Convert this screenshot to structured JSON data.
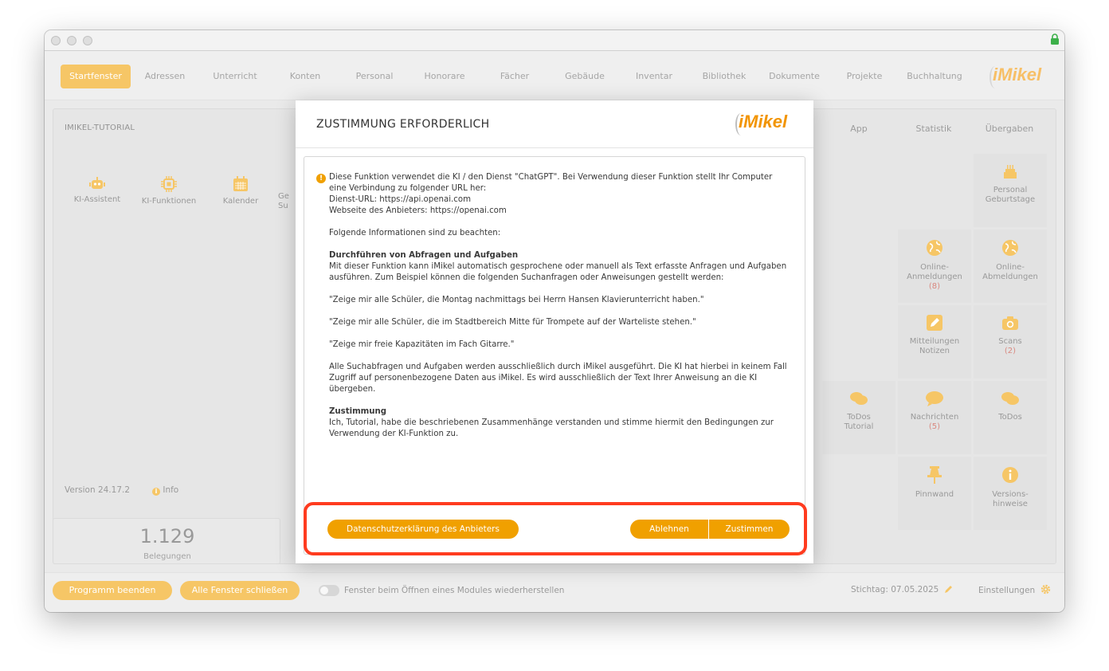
{
  "nav": {
    "items": [
      "Startfenster",
      "Adressen",
      "Unterricht",
      "Konten",
      "Personal",
      "Honorare",
      "Fächer",
      "Gebäude",
      "Inventar",
      "Bibliothek",
      "Dokumente",
      "Projekte",
      "Buchhaltung"
    ],
    "active_index": 0,
    "logo_text": "iMikel"
  },
  "panel": {
    "title": "IMIKEL-TUTORIAL",
    "tiles": [
      {
        "label": "KI-Assistent",
        "icon": "robot-icon"
      },
      {
        "label": "KI-Funktionen",
        "icon": "chip-icon"
      },
      {
        "label": "Kalender",
        "icon": "calendar-icon"
      }
    ],
    "partial_tile_label_1": "Ge",
    "partial_tile_label_2": "Su",
    "version": "Version 24.17.2",
    "info_label": "Info"
  },
  "right_tabs": [
    "App",
    "Statistik",
    "Übergaben"
  ],
  "right_tiles": [
    {
      "line1": "Personal",
      "line2": "Geburtstage",
      "count": "",
      "icon": "cake-icon"
    },
    {
      "line1": "Online-",
      "line2": "Anmeldungen",
      "count": "(8)",
      "icon": "globe-icon"
    },
    {
      "line1": "Online-",
      "line2": "Abmeldungen",
      "count": "",
      "icon": "globe-icon"
    },
    {
      "line1": "Mitteilungen",
      "line2": "Notizen",
      "count": "",
      "icon": "edit-icon"
    },
    {
      "line1": "Scans",
      "line2": "",
      "count": "(2)",
      "icon": "camera-icon"
    },
    {
      "line1": "ToDos",
      "line2": "Tutorial",
      "count": "",
      "icon": "chat-icon"
    },
    {
      "line1": "Nachrichten",
      "line2": "",
      "count": "(5)",
      "icon": "chat-icon"
    },
    {
      "line1": "ToDos",
      "line2": "",
      "count": "",
      "icon": "chat-icon"
    },
    {
      "line1": "Pinnwand",
      "line2": "",
      "count": "",
      "icon": "pin-icon"
    },
    {
      "line1": "Versions-",
      "line2": "hinweise",
      "count": "",
      "icon": "info-icon"
    }
  ],
  "stats": {
    "value": "1.129",
    "label": "Belegungen"
  },
  "bottom": {
    "quit_label": "Programm beenden",
    "close_all_label": "Alle Fenster schließen",
    "restore_label": "Fenster beim Öffnen eines Modules wiederherstellen",
    "date_label": "Stichtag: 07.05.2025",
    "settings_label": "Einstellungen"
  },
  "modal": {
    "title": "ZUSTIMMUNG ERFORDERLICH",
    "logo_text": "iMikel",
    "p1_line1": "Diese Funktion verwendet die KI / den Dienst \"ChatGPT\". Bei Verwendung dieser Funktion stellt Ihr Computer",
    "p1_line2": "eine Verbindung zu folgender URL her:",
    "p1_line3": "Dienst-URL: https://api.openai.com",
    "p1_line4": "Webseite des Anbieters: https://openai.com",
    "p2": "Folgende Informationen sind zu beachten:",
    "h1": "Durchführen von Abfragen und Aufgaben",
    "p3_line1": "Mit dieser Funktion kann iMikel automatisch gesprochene oder manuell als Text erfasste Anfragen und Aufgaben",
    "p3_line2": "ausführen. Zum Beispiel können die folgenden Suchanfragen oder Anweisungen gestellt werden:",
    "q1": "\"Zeige mir alle Schüler, die Montag nachmittags bei Herrn Hansen Klavierunterricht haben.\"",
    "q2": "\"Zeige mir alle Schüler, die im Stadtbereich Mitte für Trompete auf der Warteliste stehen.\"",
    "q3": "\"Zeige mir freie Kapazitäten im Fach Gitarre.\"",
    "p4_line1": "Alle Suchabfragen und Aufgaben werden ausschließlich durch iMikel ausgeführt. Die KI hat hierbei in keinem Fall",
    "p4_line2": "Zugriff auf personenbezogene Daten aus iMikel. Es wird ausschließlich der Text Ihrer Anweisung an die KI",
    "p4_line3": "übergeben.",
    "h2": "Zustimmung",
    "p5_line1": "Ich, Tutorial, habe die beschriebenen Zusammenhänge verstanden und stimme hiermit den Bedingungen zur",
    "p5_line2": "Verwendung der KI-Funktion zu.",
    "privacy_label": "Datenschutzerklärung des Anbieters",
    "decline_label": "Ablehnen",
    "accept_label": "Zustimmen"
  },
  "colors": {
    "accent": "#f0a000",
    "highlight": "#ff3b1f",
    "count": "#c0392b"
  }
}
